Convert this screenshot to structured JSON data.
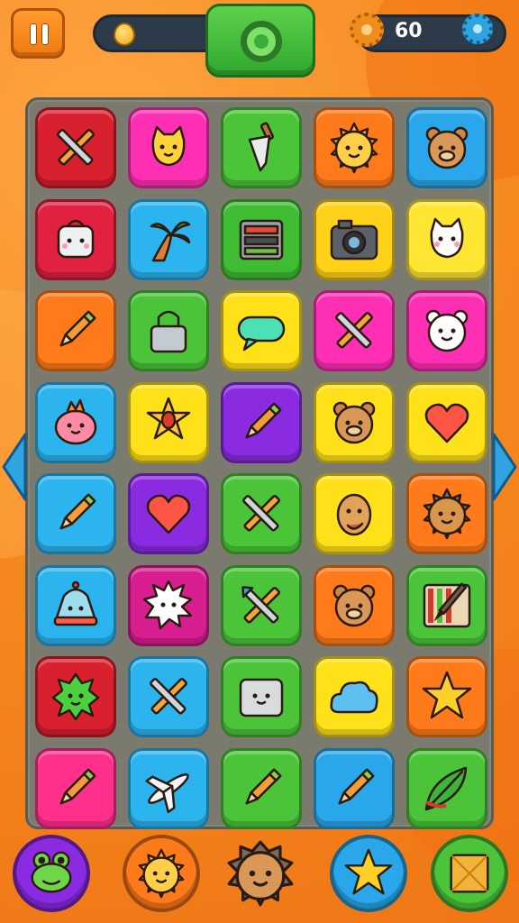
{
  "hud": {
    "score_value": "60"
  },
  "board": {
    "rows": [
      [
        {
          "color": "#d8202e",
          "icon": "crossed-pencils-icon"
        },
        {
          "color": "#ff2fb4",
          "icon": "cat-face-icon"
        },
        {
          "color": "#4cc43a",
          "icon": "trowel-icon"
        },
        {
          "color": "#ff7a1a",
          "icon": "sun-face-icon"
        },
        {
          "color": "#2aa7ea",
          "icon": "bear-face-icon"
        }
      ],
      [
        {
          "color": "#e0213f",
          "icon": "bag-face-icon"
        },
        {
          "color": "#2cb4ee",
          "icon": "palm-tree-icon"
        },
        {
          "color": "#3fbb34",
          "icon": "control-panel-icon"
        },
        {
          "color": "#ffd21a",
          "icon": "camera-icon"
        },
        {
          "color": "#ffe633",
          "icon": "white-cat-icon"
        }
      ],
      [
        {
          "color": "#ff7a1a",
          "icon": "pencil-icon"
        },
        {
          "color": "#4cc43a",
          "icon": "padlock-icon"
        },
        {
          "color": "#ffe11a",
          "icon": "speech-bubble-icon"
        },
        {
          "color": "#ff2fb4",
          "icon": "crossed-pencils-icon"
        },
        {
          "color": "#ff2fb4",
          "icon": "white-bear-icon"
        }
      ],
      [
        {
          "color": "#2cb4ee",
          "icon": "pink-blob-icon"
        },
        {
          "color": "#ffe11a",
          "icon": "gem-star-icon"
        },
        {
          "color": "#8a2be2",
          "icon": "pencil-icon"
        },
        {
          "color": "#ffe11a",
          "icon": "bear-face-icon"
        },
        {
          "color": "#ffe11a",
          "icon": "heart-icon"
        }
      ],
      [
        {
          "color": "#2cb4ee",
          "icon": "pencil-icon"
        },
        {
          "color": "#8a2be2",
          "icon": "heart-icon"
        },
        {
          "color": "#4cc43a",
          "icon": "crossed-pencils-icon"
        },
        {
          "color": "#ffe11a",
          "icon": "monkey-face-icon"
        },
        {
          "color": "#ff7a1a",
          "icon": "spiky-sun-icon"
        }
      ],
      [
        {
          "color": "#2cb4ee",
          "icon": "bell-face-icon"
        },
        {
          "color": "#d61e8f",
          "icon": "spiky-ghost-icon"
        },
        {
          "color": "#4cc43a",
          "icon": "crossed-tools-icon"
        },
        {
          "color": "#ff7a1a",
          "icon": "bear-face-icon"
        },
        {
          "color": "#4cc43a",
          "icon": "paint-brush-icon"
        }
      ],
      [
        {
          "color": "#d8202e",
          "icon": "green-monster-icon"
        },
        {
          "color": "#2cb4ee",
          "icon": "crossed-pencils-icon"
        },
        {
          "color": "#4cc43a",
          "icon": "box-face-icon"
        },
        {
          "color": "#ffe11a",
          "icon": "cloud-icon"
        },
        {
          "color": "#ff7a1a",
          "icon": "star-icon"
        }
      ],
      [
        {
          "color": "#ff2f8c",
          "icon": "pencil-icon"
        },
        {
          "color": "#2cb4ee",
          "icon": "airplane-icon"
        },
        {
          "color": "#4cc43a",
          "icon": "pencil-icon"
        },
        {
          "color": "#2aa7ea",
          "icon": "pencil-icon"
        },
        {
          "color": "#4cc43a",
          "icon": "leaf-icon"
        }
      ]
    ]
  },
  "powerups": [
    {
      "color": "#8a2be2",
      "icon": "frog-face-icon"
    },
    {
      "color": "#ff7a1a",
      "icon": "sun-face-icon"
    },
    {
      "color": "#e0a040",
      "icon": "hedgehog-face-icon"
    },
    {
      "color": "#2aa7ea",
      "icon": "star-icon"
    },
    {
      "color": "#4cc43a",
      "icon": "gem-square-icon"
    }
  ]
}
